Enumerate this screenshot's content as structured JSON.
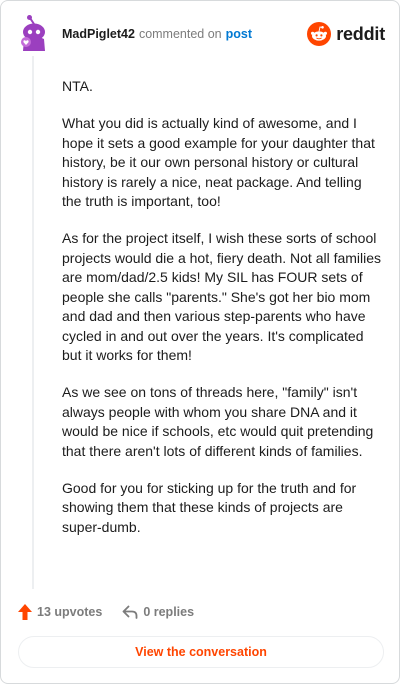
{
  "header": {
    "author": "MadPiglet42",
    "action_text": "commented on",
    "post_link": "post",
    "brand": "reddit"
  },
  "comment": {
    "paragraphs": [
      "NTA.",
      "What you did is actually kind of awesome, and I hope it sets a good example for your daughter that history, be it our own personal history or cultural history is rarely a nice, neat package. And telling the truth is important, too!",
      "As for the project itself, I wish these sorts of school projects would die a hot, fiery death. Not all families are mom/dad/2.5 kids! My SIL has FOUR sets of people she calls \"parents.\" She's got her bio mom and dad and then various step-parents who have cycled in and out over the years. It's complicated but it works for them!",
      "As we see on tons of threads here, \"family\" isn't always people with whom you share DNA and it would be nice if schools, etc would quit pretending that there aren't lots of different kinds of families.",
      "Good for you for sticking up for the truth and for showing them that these kinds of projects are super-dumb."
    ]
  },
  "actions": {
    "upvotes": "13 upvotes",
    "replies": "0 replies"
  },
  "view_button": "View the conversation",
  "colors": {
    "brand_orange": "#ff4500",
    "link_blue": "#0079d3",
    "avatar_purple": "#9b3fbf"
  },
  "icons": [
    "avatar-icon",
    "reddit-logo-icon",
    "upvote-arrow-icon",
    "reply-arrow-icon"
  ]
}
